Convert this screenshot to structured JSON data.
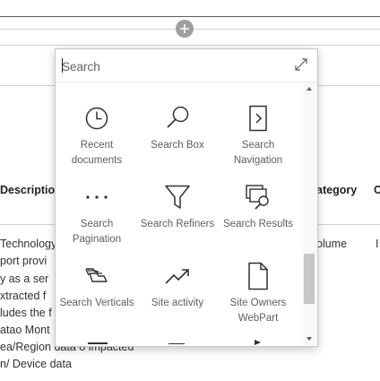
{
  "background": {
    "columns": {
      "description": "Descriptio",
      "category": "ategory",
      "last": "C"
    },
    "description_lines": [
      "Technology",
      "port provi",
      "y as a ser",
      "xtracted f",
      "ludes the f",
      "atao Mont",
      "ea/Region data o impacted",
      "n/ Device data"
    ],
    "category_value": "olume",
    "last_value": "I"
  },
  "add_button": {
    "icon": "plus-icon"
  },
  "picker": {
    "search": {
      "placeholder": "Search",
      "value": ""
    },
    "expand_icon": "expand-icon",
    "tiles": [
      {
        "label": "Recent documents",
        "icon": "clock-icon"
      },
      {
        "label": "Search Box",
        "icon": "magnifier-icon"
      },
      {
        "label": "Search Navigation",
        "icon": "document-chevron-icon"
      },
      {
        "label": "Search Pagination",
        "icon": "ellipsis-icon"
      },
      {
        "label": "Search Refiners",
        "icon": "filter-icon"
      },
      {
        "label": "Search Results",
        "icon": "search-results-icon"
      },
      {
        "label": "Search Verticals",
        "icon": "stacked-tabs-icon"
      },
      {
        "label": "Site activity",
        "icon": "trend-icon"
      },
      {
        "label": "Site Owners WebPart",
        "icon": "blank-page-icon"
      }
    ],
    "colors": {
      "icon": "#323130",
      "label": "#605e5c",
      "border": "#c8c6c4"
    }
  }
}
